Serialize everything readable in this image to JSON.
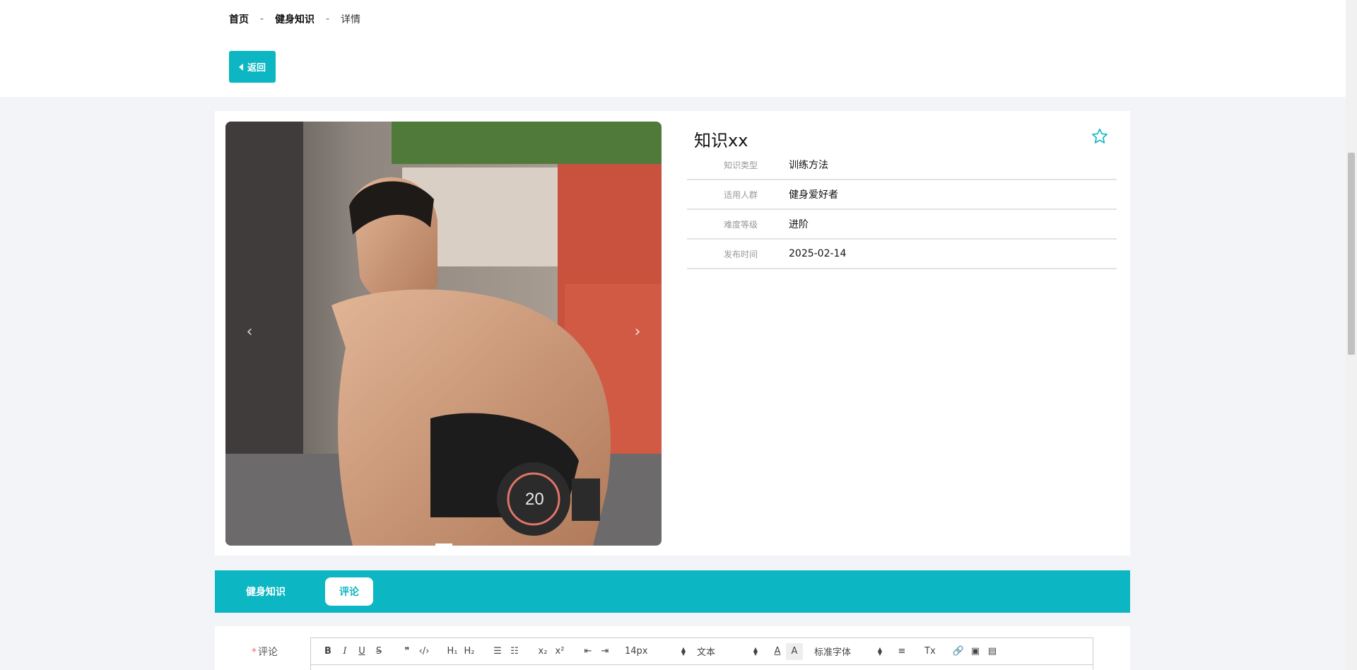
{
  "breadcrumb": {
    "home": "首页",
    "section": "健身知识",
    "current": "详情",
    "separator": "-"
  },
  "back_button": {
    "label": "返回",
    "icon": "caret-left-icon"
  },
  "colors": {
    "accent": "#0cb6c3",
    "star": "#0cb6c3",
    "required": "#f56c6c"
  },
  "carousel": {
    "prev": "‹",
    "next": "›",
    "slides": 2,
    "active_slide": 1,
    "image_alt": "fitness-man-dumbbell-photo"
  },
  "detail": {
    "title": "知识xx",
    "favorite_icon": "star-outline-icon",
    "fields": [
      {
        "label": "知识类型",
        "value": "训练方法"
      },
      {
        "label": "适用人群",
        "value": "健身爱好者"
      },
      {
        "label": "难度等级",
        "value": "进阶"
      },
      {
        "label": "发布时间",
        "value": "2025-02-14"
      }
    ]
  },
  "tabs": {
    "knowledge": "健身知识",
    "comment": "评论",
    "active": "comment"
  },
  "comment": {
    "required_mark": "*",
    "label": "评论"
  },
  "toolbar": {
    "bold": "B",
    "italic": "I",
    "underline": "U",
    "strike": "S",
    "blockquote": "❞",
    "code": "‹/›",
    "h1": "H₁",
    "h2": "H₂",
    "ordered_list": "☰",
    "bullet_list": "☷",
    "subscript": "x₂",
    "superscript": "x²",
    "outdent": "⇤",
    "indent": "⇥",
    "size": "14px",
    "format": "文本",
    "color": "A",
    "background": "A",
    "font": "标准字体",
    "align": "≡",
    "clean": "Tx",
    "link": "🔗",
    "image": "▣",
    "video": "▤"
  }
}
